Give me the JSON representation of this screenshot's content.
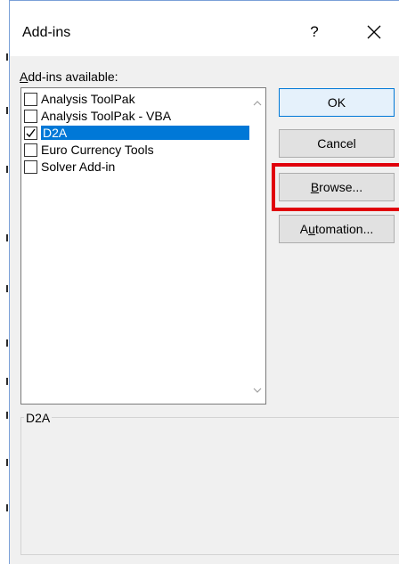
{
  "dialog": {
    "title": "Add-ins",
    "help_label": "?",
    "close_icon": "close-icon"
  },
  "addins": {
    "label_prefix": "A",
    "label_rest": "dd-ins available:",
    "items": [
      {
        "label": "Analysis ToolPak",
        "checked": false,
        "selected": false
      },
      {
        "label": "Analysis ToolPak - VBA",
        "checked": false,
        "selected": false
      },
      {
        "label": "D2A",
        "checked": true,
        "selected": true
      },
      {
        "label": "Euro Currency Tools",
        "checked": false,
        "selected": false
      },
      {
        "label": "Solver Add-in",
        "checked": false,
        "selected": false
      }
    ]
  },
  "buttons": {
    "ok": "OK",
    "cancel": "Cancel",
    "browse_mnemonic": "B",
    "browse_rest": "rowse...",
    "automation_pre": "A",
    "automation_mnemonic": "u",
    "automation_rest": "tomation..."
  },
  "description": {
    "group_title": "D2A"
  },
  "colors": {
    "highlight_border": "#e0000b",
    "selection": "#0078d7"
  }
}
